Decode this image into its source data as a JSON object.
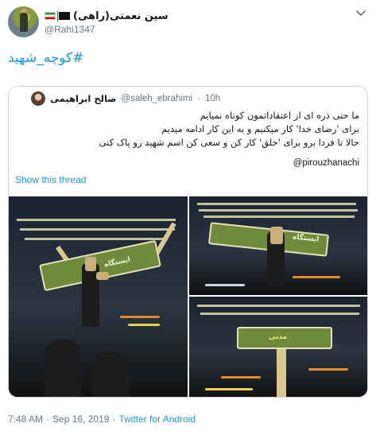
{
  "tweet": {
    "display_name": "سین نعمتی(راهی)",
    "handle": "@Rahi1347",
    "hashtag": "#کوچه_شهید"
  },
  "quoted": {
    "display_name": "صالح ابراهیمی",
    "handle": "@saleh_ebrahimi",
    "separator": "·",
    "time": "10h",
    "lines": [
      "ما حتی ذره ای از اعتقاداتمون کوتاه نمیایم",
      "برای 'رضای خدا' کار میکنیم و به این کار ادامه میدیم",
      "حالا تا فردا برو برای 'خلق' کار کن و سعی کن اسم شهید رو پاک کنی"
    ],
    "mention": "@pirouzhanachi",
    "show_thread": "Show this thread"
  },
  "photos": {
    "sign_text_1": "ایستگاه",
    "sign_text_2": "ایستگاه",
    "sign_text_3": "مدنی"
  },
  "footer": {
    "time": "7:48 AM",
    "dot1": "·",
    "date": "Sep 16, 2019",
    "dot2": "·",
    "source": "Twitter for Android"
  },
  "colors": {
    "link": "#1b95e0",
    "muted": "#657786",
    "border": "#ccd6dd"
  }
}
